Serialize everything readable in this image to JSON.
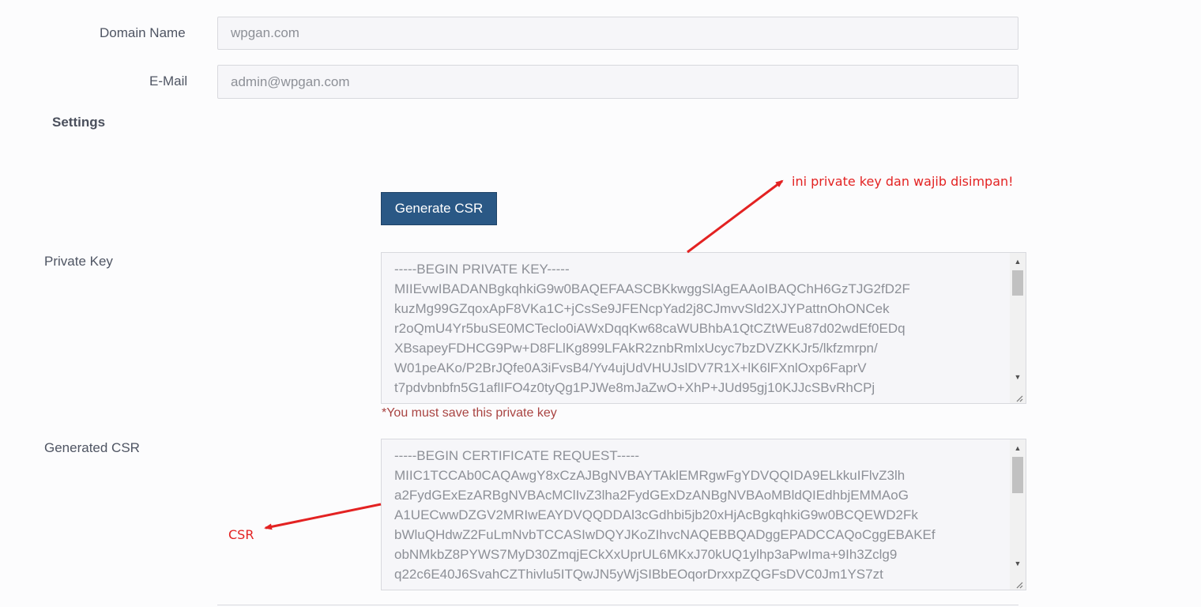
{
  "form": {
    "domain_label": "Domain Name",
    "domain_value": "wpgan.com",
    "email_label": "E-Mail",
    "email_value": "admin@wpgan.com",
    "settings_title": "Settings",
    "generate_button": "Generate CSR",
    "private_key_label": "Private Key",
    "private_key_lines": [
      "-----BEGIN PRIVATE KEY-----",
      "MIIEvwIBADANBgkqhkiG9w0BAQEFAASCBKkwggSlAgEAAoIBAQChH6GzTJG2fD2F",
      "kuzMg99GZqoxApF8VKa1C+jCsSe9JFENcpYad2j8CJmvvSld2XJYPattnOhONCek",
      "r2oQmU4Yr5buSE0MCTeclo0iAWxDqqKw68caWUBhbA1QtCZtWEu87d02wdEf0EDq",
      "XBsapeyFDHCG9Pw+D8FLlKg899LFAkR2znbRmlxUcyc7bzDVZKKJr5/lkfzmrpn/",
      "W01peAKo/P2BrJQfe0A3iFvsB4/Yv4ujUdVHUJslDV7R1X+lK6lFXnlOxp6FaprV",
      "t7pdvbnbfn5G1aflIFO4z0tyQg1PJWe8mJaZwO+XhP+JUd95gj10KJJcSBvRhCPj"
    ],
    "private_key_warning": "*You must save this private key",
    "csr_label": "Generated CSR",
    "csr_lines": [
      "-----BEGIN CERTIFICATE REQUEST-----",
      "MIIC1TCCAb0CAQAwgY8xCzAJBgNVBAYTAklEMRgwFgYDVQQIDA9ELkkuIFlvZ3lh",
      "a2FydGExEzARBgNVBAcMClIvZ3lha2FydGExDzANBgNVBAoMBldQIEdhbjEMMAoG",
      "A1UECwwDZGV2MRIwEAYDVQQDDAl3cGdhbi5jb20xHjAcBgkqhkiG9w0BCQEWD2Fk",
      "bWluQHdwZ2FuLmNvbTCCASIwDQYJKoZIhvcNAQEBBQADggEPADCCAQoCggEBAKEf",
      "obNMkbZ8PYWS7MyD30ZmqjECkXxUprUL6MKxJ70kUQ1ylhp3aPwIma+9Ih3Zclg9",
      "q22c6E40J6SvahCZThivlu5ITQwJN5yWjSIBbEOqorDrxxpZQGFsDVC0Jm1YS7zt"
    ]
  },
  "annotations": {
    "private_key_note": "ini private key dan wajib disimpan!",
    "csr_note": "CSR",
    "color": "#e32222"
  },
  "theme": {
    "button_bg": "#2a5885",
    "warning_color": "#a94442"
  }
}
